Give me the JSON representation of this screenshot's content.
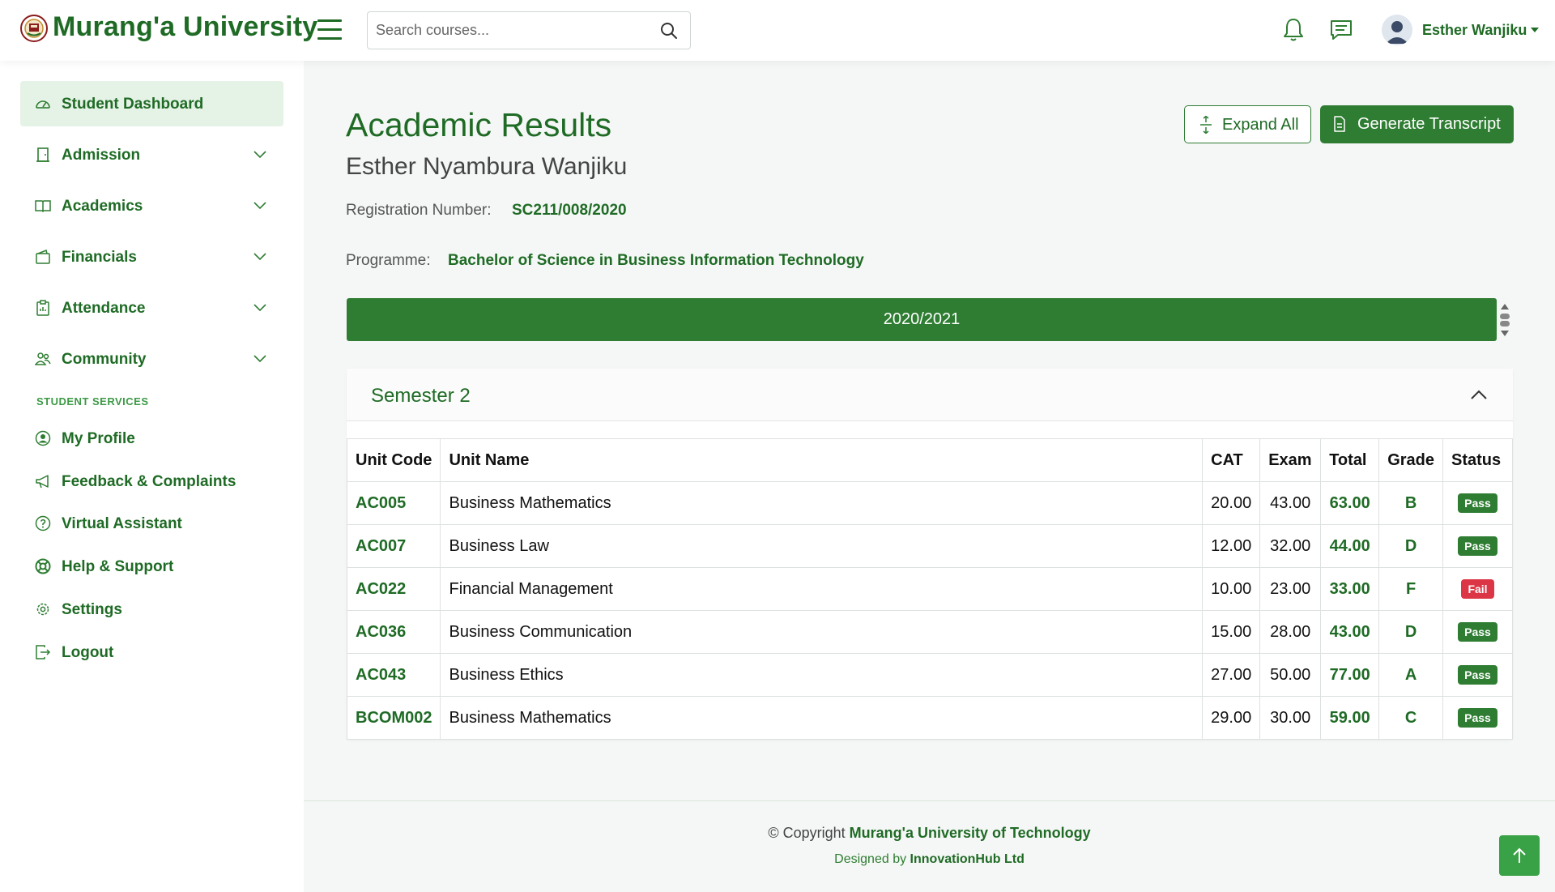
{
  "header": {
    "brand": "Murang'a University",
    "search_placeholder": "Search courses...",
    "username": "Esther Wanjiku"
  },
  "sidebar": {
    "items": [
      {
        "label": "Student Dashboard",
        "icon": "dashboard-icon",
        "active": true
      },
      {
        "label": "Admission",
        "icon": "door-icon",
        "expandable": true
      },
      {
        "label": "Academics",
        "icon": "book-icon",
        "expandable": true
      },
      {
        "label": "Financials",
        "icon": "wallet-icon",
        "expandable": true
      },
      {
        "label": "Attendance",
        "icon": "clipboard-icon",
        "expandable": true
      },
      {
        "label": "Community",
        "icon": "people-icon",
        "expandable": true
      }
    ],
    "section_label": "STUDENT SERVICES",
    "services": [
      {
        "label": "My Profile",
        "icon": "user-circle-icon"
      },
      {
        "label": "Feedback & Complaints",
        "icon": "megaphone-icon"
      },
      {
        "label": "Virtual Assistant",
        "icon": "question-circle-icon"
      },
      {
        "label": "Help & Support",
        "icon": "lifebuoy-icon"
      },
      {
        "label": "Settings",
        "icon": "gear-icon"
      },
      {
        "label": "Logout",
        "icon": "logout-icon"
      }
    ]
  },
  "main": {
    "title": "Academic Results",
    "student_name": "Esther Nyambura Wanjiku",
    "reg_label": "Registration Number:",
    "reg_value": "SC211/008/2020",
    "programme_label": "Programme:",
    "programme_value": "Bachelor of Science in Business Information Technology",
    "expand_all_label": "Expand All",
    "transcript_label": "Generate Transcript",
    "academic_year": "2020/2021",
    "semester_title": "Semester 2",
    "table": {
      "headers": [
        "Unit Code",
        "Unit Name",
        "CAT",
        "Exam",
        "Total",
        "Grade",
        "Status"
      ],
      "rows": [
        {
          "code": "AC005",
          "name": "Business Mathematics",
          "cat": "20.00",
          "exam": "43.00",
          "total": "63.00",
          "grade": "B",
          "status": "Pass"
        },
        {
          "code": "AC007",
          "name": "Business Law",
          "cat": "12.00",
          "exam": "32.00",
          "total": "44.00",
          "grade": "D",
          "status": "Pass"
        },
        {
          "code": "AC022",
          "name": "Financial Management",
          "cat": "10.00",
          "exam": "23.00",
          "total": "33.00",
          "grade": "F",
          "status": "Fail"
        },
        {
          "code": "AC036",
          "name": "Business Communication",
          "cat": "15.00",
          "exam": "28.00",
          "total": "43.00",
          "grade": "D",
          "status": "Pass"
        },
        {
          "code": "AC043",
          "name": "Business Ethics",
          "cat": "27.00",
          "exam": "50.00",
          "total": "77.00",
          "grade": "A",
          "status": "Pass"
        },
        {
          "code": "BCOM002",
          "name": "Business Mathematics",
          "cat": "29.00",
          "exam": "30.00",
          "total": "59.00",
          "grade": "C",
          "status": "Pass"
        }
      ]
    }
  },
  "footer": {
    "copyright_prefix": "© Copyright",
    "copyright_org": "Murang'a University of Technology",
    "designed_prefix": "Designed by",
    "designed_org": "InnovationHub Ltd"
  },
  "colors": {
    "primary": "#2e7d32",
    "text_green": "#1f6b25",
    "fail_red": "#dc3545",
    "active_bg": "#e5f2e6"
  }
}
